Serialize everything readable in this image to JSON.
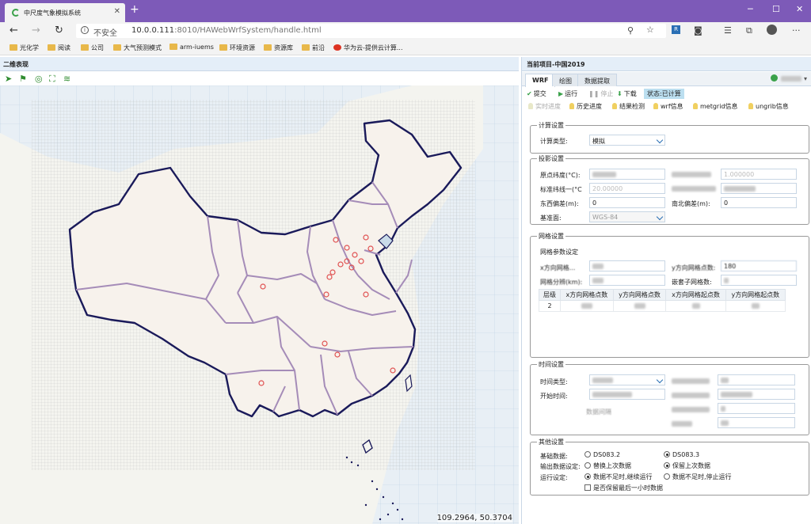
{
  "browser": {
    "tab_title": "中尺度气象模拟系统",
    "insecure_label": "不安全",
    "url_host": "10.0.0.111",
    "url_rest": ":8010/HAWebWrfSystem/handle.html",
    "bookmarks": [
      "光化学",
      "阅读",
      "公司",
      "大气预测模式",
      "arm-iuems",
      "环境资源",
      "资源库",
      "前沿",
      "华为云-提供云计算..."
    ]
  },
  "left_panel": {
    "title": "二维表现",
    "coordinates": "109.2964, 50.3704"
  },
  "right_panel": {
    "header": "当前项目-中国2019",
    "tabs": [
      {
        "label": "WRF",
        "active": true
      },
      {
        "label": "绘图",
        "active": false
      },
      {
        "label": "数据提取",
        "active": false
      }
    ],
    "actions": {
      "submit": "提交",
      "run": "运行",
      "stop": "停止",
      "download": "下载",
      "status": "状态:已计算"
    },
    "links": {
      "realtime": "实时进度",
      "history": "历史进度",
      "check": "结果检测",
      "wrf_info": "wrf信息",
      "metgrid_info": "metgrid信息",
      "ungrib_info": "ungrib信息"
    },
    "calc": {
      "legend": "计算设置",
      "type_label": "计算类型:",
      "type_value": "模拟"
    },
    "projection": {
      "legend": "投影设置",
      "lat_label": "原点纬度(°C):",
      "std_lon_label": "标准纬线一(°C",
      "std_lon_value": "20.00000",
      "false_east_label": "东西偏差(m):",
      "false_east_value": "0",
      "false_north_label": "南北偏差(m):",
      "false_north_value": "0",
      "datum_label": "基准面:",
      "datum_value": "WGS-84",
      "right_val1": "1.000000"
    },
    "grid": {
      "legend": "网格设置",
      "sub": "网格参数设定",
      "x_label": "x方向网格...",
      "y_label": "y方向网格点数:",
      "y_value": "180",
      "res_label": "网格分辨(km):",
      "nest_label": "嵌套子网格数:",
      "table_headers": [
        "层级",
        "x方向网格点数",
        "y方向网格点数",
        "x方向网格起点数",
        "y方向网格起点数"
      ],
      "table_rows": [
        [
          "2",
          "",
          "",
          "",
          ""
        ]
      ]
    },
    "time": {
      "legend": "时间设置",
      "type_label": "时间类型:",
      "start_label": "开始时间:",
      "hint": "数据间隔"
    },
    "other": {
      "legend": "其他设置",
      "base_label": "基础数据:",
      "base_opt1": "DS083.2",
      "base_opt2": "DS083.3",
      "out_label": "输出数据设定:",
      "out_opt1": "替换上次数据",
      "out_opt2": "保留上次数据",
      "run_label": "运行设定:",
      "run_opt1": "数据不足时,继续运行",
      "run_opt2": "数据不足时,停止运行",
      "keep_last": "是否保留最后一小时数据"
    }
  },
  "colors": {
    "titlebar": "#7d5ab8",
    "accent": "#2a6fb5",
    "border_line": "#1a1a5a",
    "province_line": "#a58cb8",
    "station": "#e05050"
  }
}
